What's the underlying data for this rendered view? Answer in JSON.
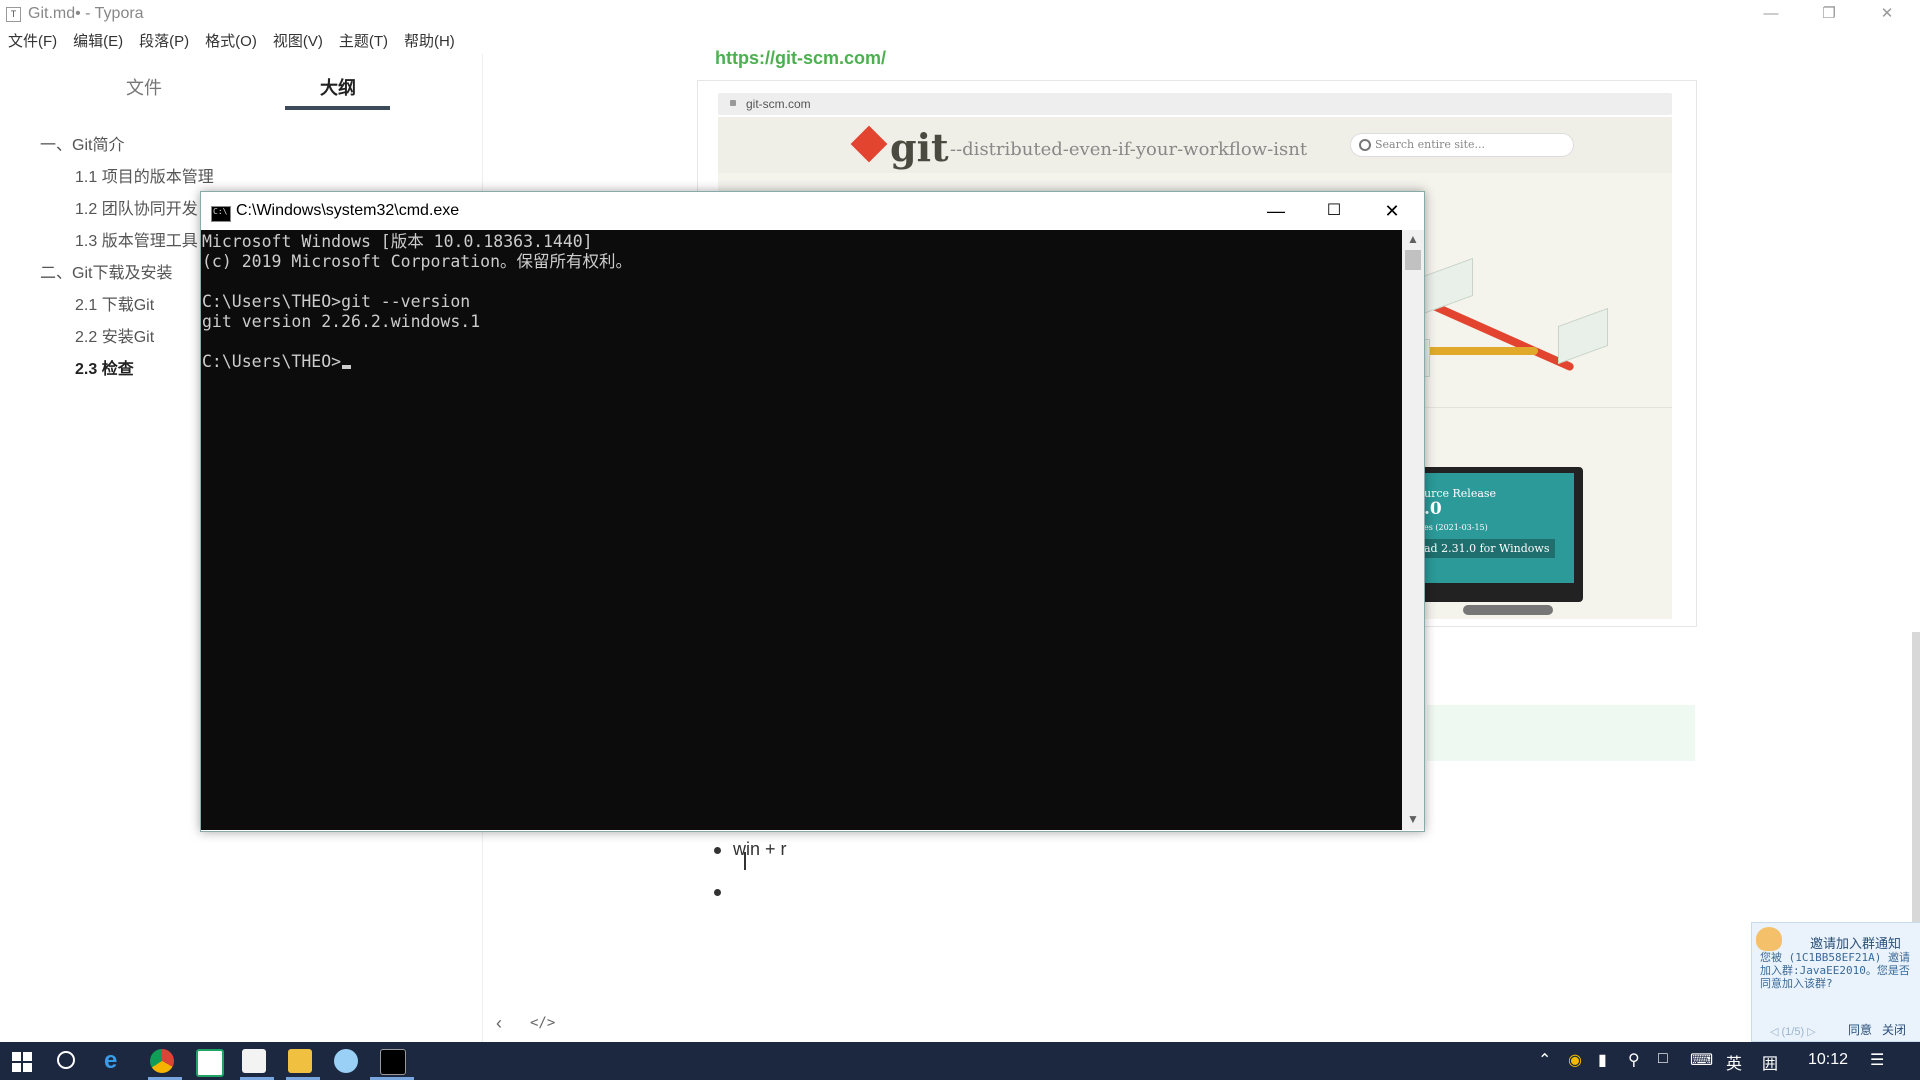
{
  "window": {
    "title": "Git.md• - Typora",
    "app_icon": "T"
  },
  "menu": [
    "文件(F)",
    "编辑(E)",
    "段落(P)",
    "格式(O)",
    "视图(V)",
    "主题(T)",
    "帮助(H)"
  ],
  "sidebar": {
    "tabs": [
      {
        "label": "文件",
        "active": false
      },
      {
        "label": "大纲",
        "active": true
      }
    ],
    "outline": [
      {
        "label": "一、Git简介",
        "level": 1,
        "active": false
      },
      {
        "label": "1.1 项目的版本管理",
        "level": 2,
        "active": false
      },
      {
        "label": "1.2 团队协同开发",
        "level": 2,
        "active": false
      },
      {
        "label": "1.3 版本管理工具",
        "level": 2,
        "active": false
      },
      {
        "label": "二、Git下载及安装",
        "level": 1,
        "active": false
      },
      {
        "label": "2.1 下载Git",
        "level": 2,
        "active": false
      },
      {
        "label": "2.2 安装Git",
        "level": 2,
        "active": false
      },
      {
        "label": "2.3 检查",
        "level": 2,
        "active": true
      }
    ]
  },
  "editor": {
    "link": "https://git-scm.com/",
    "screenshot": {
      "url": "git-scm.com",
      "logo_text": "git",
      "tagline": "--distributed-even-if-your-workflow-isnt",
      "search_placeholder": "Search entire site...",
      "release_title": "urce Release",
      "release_version": ".0",
      "release_date": "es (2021-03-15)",
      "download_button": "ad 2.31.0 for Windows"
    },
    "bullets": [
      "win + r",
      ""
    ]
  },
  "cmd": {
    "title": "C:\\Windows\\system32\\cmd.exe",
    "icon_text": "C:\\",
    "lines": [
      "Microsoft Windows [版本 10.0.18363.1440]",
      "(c) 2019 Microsoft Corporation。保留所有权利。",
      "",
      "C:\\Users\\THEO>git --version",
      "git version 2.26.2.windows.1",
      "",
      "C:\\Users\\THEO>"
    ]
  },
  "qq_notice": {
    "title": "邀请加入群通知",
    "body": "您被 (1C1BB58EF21A) 邀请加入群:JavaEE2010。您是否同意加入该群?",
    "pager": "◁ (1/5) ▷",
    "accept": "同意",
    "close": "关闭"
  },
  "taskbar": {
    "time": "10:12",
    "ime": "英",
    "ime2": "囲"
  },
  "colors": {
    "link_green": "#4caf50",
    "console_bg": "#0c0c0c",
    "console_fg": "#cccccc",
    "taskbar": "#1c2840",
    "git_red": "#e2442f"
  }
}
